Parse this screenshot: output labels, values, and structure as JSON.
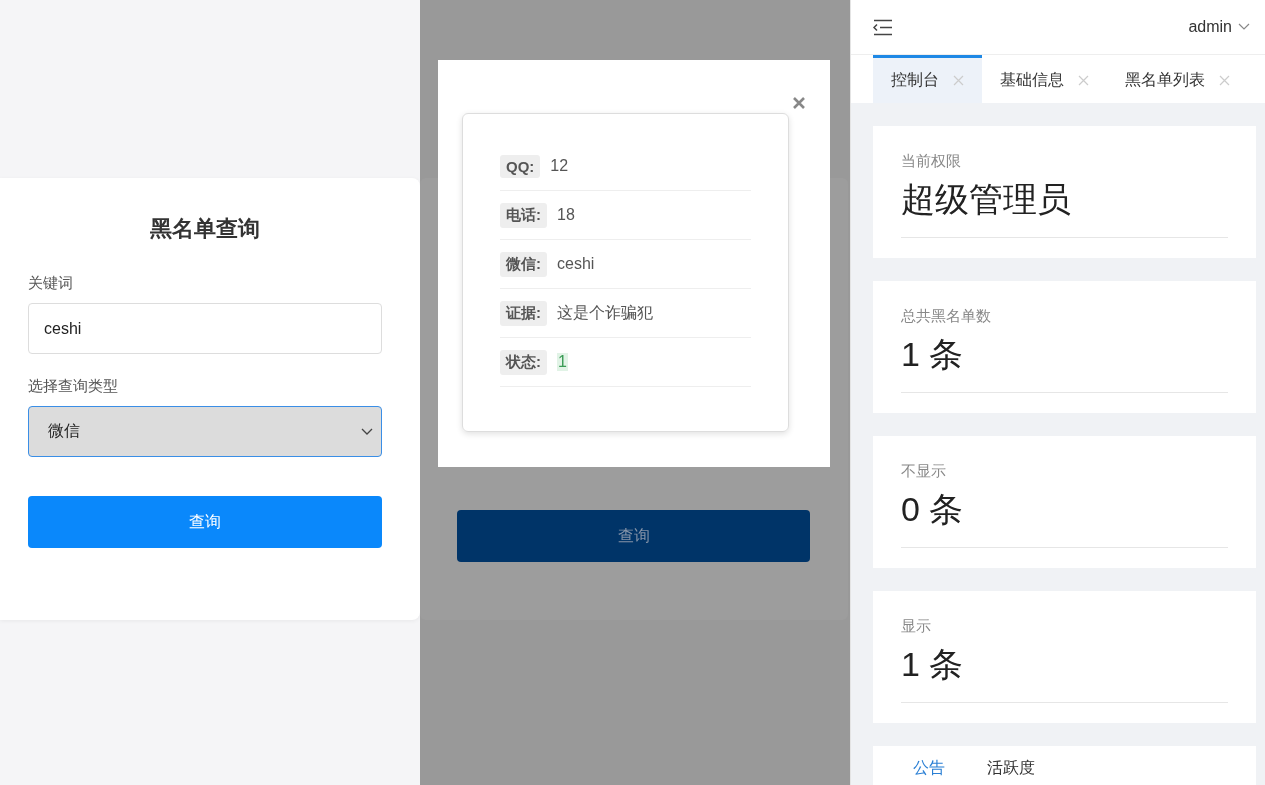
{
  "query_form": {
    "title": "黑名单查询",
    "keyword_label": "关键词",
    "keyword_value": "ceshi",
    "type_label": "选择查询类型",
    "type_value": "微信",
    "submit": "查询"
  },
  "dimmed_form": {
    "submit": "查询"
  },
  "result_dialog": {
    "fields": [
      {
        "label": "QQ:",
        "value": "12",
        "kind": "text"
      },
      {
        "label": "电话:",
        "value": "18",
        "kind": "text"
      },
      {
        "label": "微信:",
        "value": "ceshi",
        "kind": "text"
      },
      {
        "label": "证据:",
        "value": "这是个诈骗犯",
        "kind": "text"
      },
      {
        "label": "状态:",
        "value": "1",
        "kind": "tag"
      }
    ]
  },
  "admin": {
    "user": "admin",
    "tabs": [
      {
        "label": "控制台",
        "selected": true
      },
      {
        "label": "基础信息",
        "selected": false
      },
      {
        "label": "黑名单列表",
        "selected": false
      }
    ],
    "stats": [
      {
        "label": "当前权限",
        "value": "超级管理员"
      },
      {
        "label": "总共黑名单数",
        "value": "1 条"
      },
      {
        "label": "不显示",
        "value": "0 条"
      },
      {
        "label": "显示",
        "value": "1 条"
      }
    ],
    "bottom_tabs": [
      {
        "label": "公告",
        "selected": true
      },
      {
        "label": "活跃度",
        "selected": false
      }
    ]
  }
}
